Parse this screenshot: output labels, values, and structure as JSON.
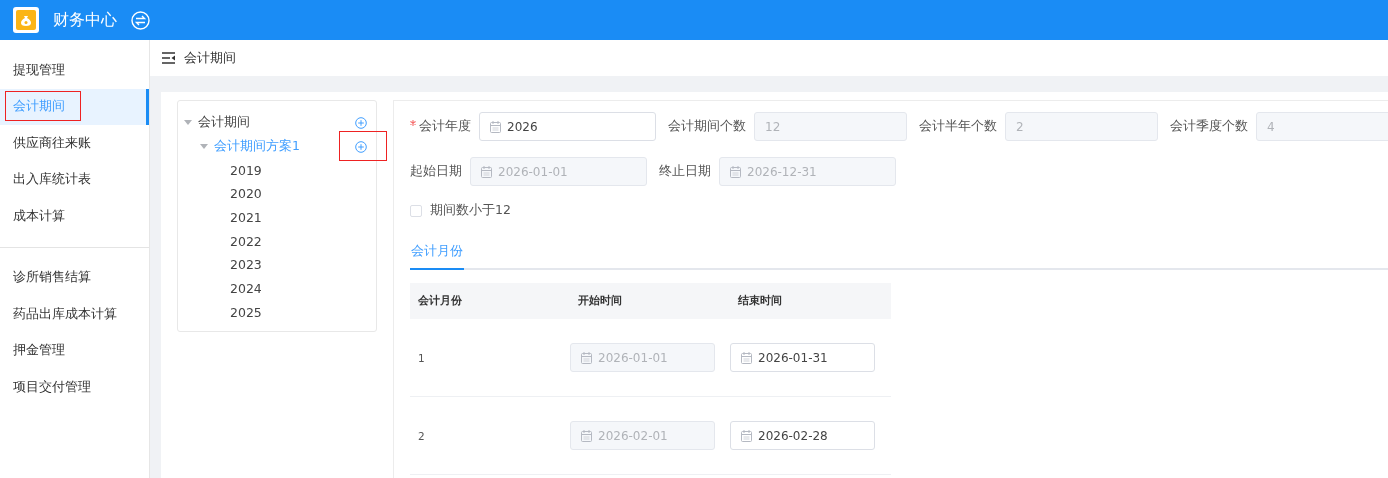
{
  "header": {
    "title": "财务中心"
  },
  "sidebar": {
    "groups": [
      [
        {
          "label": "提现管理",
          "selected": false,
          "annotated": false
        },
        {
          "label": "会计期间",
          "selected": true,
          "annotated": true
        },
        {
          "label": "供应商往来账",
          "selected": false,
          "annotated": false
        },
        {
          "label": "出入库统计表",
          "selected": false,
          "annotated": false
        },
        {
          "label": "成本计算",
          "selected": false,
          "annotated": false
        }
      ],
      [
        {
          "label": "诊所销售结算",
          "selected": false,
          "annotated": false
        },
        {
          "label": "药品出库成本计算",
          "selected": false,
          "annotated": false
        },
        {
          "label": "押金管理",
          "selected": false,
          "annotated": false
        },
        {
          "label": "项目交付管理",
          "selected": false,
          "annotated": false
        }
      ]
    ]
  },
  "breadcrumb": {
    "title": "会计期间"
  },
  "tree": [
    {
      "label": "会计期间",
      "expanded": true,
      "selected": false,
      "addable": true,
      "annotated": false,
      "children": [
        {
          "label": "会计期间方案1",
          "expanded": true,
          "selected": true,
          "addable": true,
          "annotated": true,
          "children": [
            {
              "label": "2019",
              "selected": false,
              "addable": false,
              "annotated": false
            },
            {
              "label": "2020",
              "selected": false,
              "addable": false,
              "annotated": false
            },
            {
              "label": "2021",
              "selected": false,
              "addable": false,
              "annotated": false
            },
            {
              "label": "2022",
              "selected": false,
              "addable": false,
              "annotated": false
            },
            {
              "label": "2023",
              "selected": false,
              "addable": false,
              "annotated": false
            },
            {
              "label": "2024",
              "selected": false,
              "addable": false,
              "annotated": false
            },
            {
              "label": "2025",
              "selected": false,
              "addable": false,
              "annotated": false
            }
          ]
        }
      ]
    }
  ],
  "form": {
    "rows": [
      [
        {
          "label": "会计年度",
          "required": true,
          "kind": "date",
          "value": "2026",
          "disabled": false
        },
        {
          "label": "会计期间个数",
          "required": false,
          "kind": "number",
          "value": "12",
          "disabled": true
        },
        {
          "label": "会计半年个数",
          "required": false,
          "kind": "number",
          "value": "2",
          "disabled": true
        },
        {
          "label": "会计季度个数",
          "required": false,
          "kind": "number",
          "value": "4",
          "disabled": true
        }
      ],
      [
        {
          "label": "起始日期",
          "required": false,
          "kind": "date",
          "value": "2026-01-01",
          "disabled": true
        },
        {
          "label": "终止日期",
          "required": false,
          "kind": "date",
          "value": "2026-12-31",
          "disabled": true
        }
      ]
    ],
    "checkbox": {
      "label": "期间数小于12",
      "checked": false
    }
  },
  "tabs": [
    {
      "label": "会计月份",
      "selected": true
    }
  ],
  "table": {
    "columns": [
      "会计月份",
      "开始时间",
      "结束时间"
    ],
    "rows": [
      {
        "month": "1",
        "start": {
          "value": "2026-01-01",
          "disabled": true
        },
        "end": {
          "value": "2026-01-31",
          "disabled": false
        }
      },
      {
        "month": "2",
        "start": {
          "value": "2026-02-01",
          "disabled": true
        },
        "end": {
          "value": "2026-02-28",
          "disabled": false
        }
      }
    ]
  }
}
